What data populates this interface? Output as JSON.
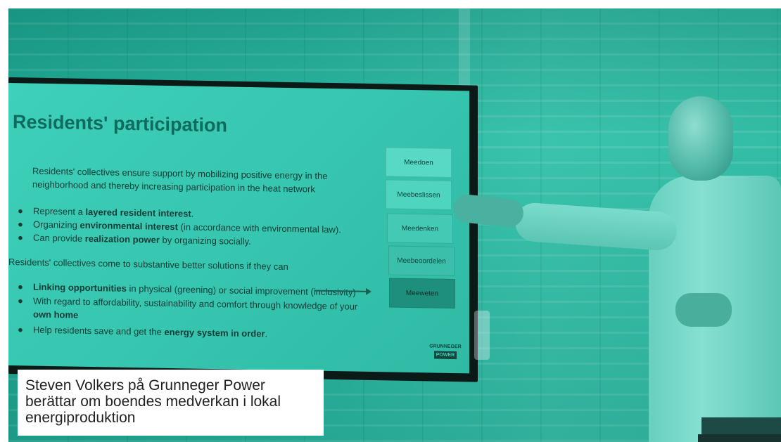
{
  "slide": {
    "title": "Residents' participation",
    "intro": "Residents' collectives ensure support by mobilizing positive energy in the neighborhood and thereby increasing participation in the heat network",
    "bullets_1": [
      {
        "pre": "Represent a ",
        "bold": "layered resident interest",
        "post": "."
      },
      {
        "pre": "Organizing ",
        "bold": "environmental interest",
        "post": " (in accordance with environmental law)."
      },
      {
        "pre": "Can provide ",
        "bold": "realization power",
        "post": " by organizing socially."
      }
    ],
    "collectives_line": "Residents' collectives come to substantive better solutions if they can",
    "bullets_2": [
      {
        "pre": "",
        "bold": "Linking opportunities",
        "post": " in physical (greening) or social improvement (inclusivity)"
      },
      {
        "pre": "With regard to affordability, sustainability and comfort through knowledge of your",
        "bold": "",
        "post": ""
      },
      {
        "pre": "",
        "bold": "own home",
        "post": ""
      },
      {
        "pre": "Help residents save and get the ",
        "bold": "energy system in order",
        "post": "."
      }
    ],
    "steps": [
      "Meedoen",
      "Meebeslissen",
      "Meedenken",
      "Meebeoordelen",
      "Meeweten"
    ],
    "logo_top": "GRUNNEGER",
    "logo_bottom": "POWER"
  },
  "caption": "Steven Volkers på Grunneger Power berättar om boendes medverkan i lokal energiproduktion",
  "colors": {
    "tint": "#27b5a0",
    "slide_title": "#0e6b5e",
    "caption_bg": "#ffffff"
  }
}
